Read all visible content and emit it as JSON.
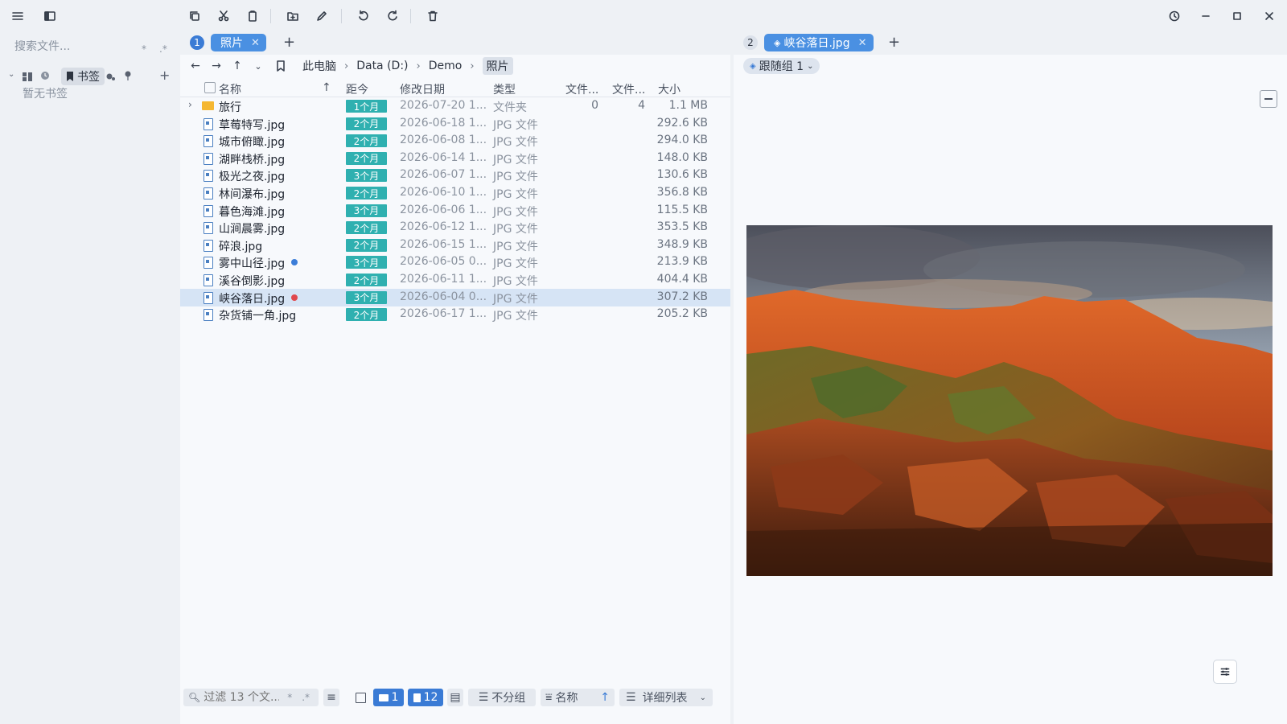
{
  "toolbar": {
    "icons": [
      "menu-icon",
      "sidebar-toggle-icon",
      "copy-icon",
      "cut-icon",
      "paste-icon",
      "new-folder-icon",
      "rename-icon",
      "undo-icon",
      "redo-icon",
      "delete-icon",
      "history-icon",
      "minimize-icon",
      "maximize-icon",
      "close-icon"
    ]
  },
  "sidebar": {
    "search_placeholder": "搜索文件...",
    "search_opt1": "*",
    "search_opt2": ".*",
    "bookmark_label": "书签",
    "empty_text": "暂无书签"
  },
  "left_pane": {
    "tab_number": "1",
    "tab_label": "照片",
    "add_tab": "+",
    "breadcrumb": [
      "此电脑",
      "Data (D:)",
      "Demo",
      "照片"
    ],
    "columns": {
      "name": "名称",
      "age": "距今",
      "modified": "修改日期",
      "type": "类型",
      "files": "文件...",
      "folders": "文件...",
      "size": "大小"
    },
    "rows": [
      {
        "name": "旅行",
        "age": "1个月",
        "modified": "2026-07-20 1...",
        "type": "文件夹",
        "files": "0",
        "folders": "4",
        "size": "1.1 MB",
        "kind": "folder"
      },
      {
        "name": "草莓特写.jpg",
        "age": "2个月",
        "modified": "2026-06-18 1...",
        "type": "JPG 文件",
        "size": "292.6 KB"
      },
      {
        "name": "城市俯瞰.jpg",
        "age": "2个月",
        "modified": "2026-06-08 1...",
        "type": "JPG 文件",
        "size": "294.0 KB"
      },
      {
        "name": "湖畔栈桥.jpg",
        "age": "2个月",
        "modified": "2026-06-14 1...",
        "type": "JPG 文件",
        "size": "148.0 KB"
      },
      {
        "name": "极光之夜.jpg",
        "age": "3个月",
        "modified": "2026-06-07 1...",
        "type": "JPG 文件",
        "size": "130.6 KB"
      },
      {
        "name": "林间瀑布.jpg",
        "age": "2个月",
        "modified": "2026-06-10 1...",
        "type": "JPG 文件",
        "size": "356.8 KB"
      },
      {
        "name": "暮色海滩.jpg",
        "age": "3个月",
        "modified": "2026-06-06 1...",
        "type": "JPG 文件",
        "size": "115.5 KB"
      },
      {
        "name": "山涧晨雾.jpg",
        "age": "2个月",
        "modified": "2026-06-12 1...",
        "type": "JPG 文件",
        "size": "353.5 KB"
      },
      {
        "name": "碎浪.jpg",
        "age": "2个月",
        "modified": "2026-06-15 1...",
        "type": "JPG 文件",
        "size": "348.9 KB"
      },
      {
        "name": "雾中山径.jpg",
        "age": "3个月",
        "modified": "2026-06-05 0...",
        "type": "JPG 文件",
        "size": "213.9 KB",
        "tag": "#3b7dd8"
      },
      {
        "name": "溪谷倒影.jpg",
        "age": "2个月",
        "modified": "2026-06-11 1...",
        "type": "JPG 文件",
        "size": "404.4 KB"
      },
      {
        "name": "峡谷落日.jpg",
        "age": "3个月",
        "modified": "2026-06-04 0...",
        "type": "JPG 文件",
        "size": "307.2 KB",
        "tag": "#e0474c",
        "selected": true
      },
      {
        "name": "杂货铺一角.jpg",
        "age": "2个月",
        "modified": "2026-06-17 1...",
        "type": "JPG 文件",
        "size": "205.2 KB"
      }
    ],
    "status": {
      "filter_placeholder": "过滤 13 个文...",
      "filter_opt1": "*",
      "filter_opt2": ".*",
      "folder_count": "1",
      "file_count": "12",
      "group_label": "不分组",
      "sort_label": "名称",
      "view_label": "详细列表"
    }
  },
  "right_pane": {
    "tab_number": "2",
    "tab_label": "峡谷落日.jpg",
    "add_tab": "+",
    "follow_group": "跟随组 1"
  },
  "colors": {
    "accent": "#4a90e2",
    "age_badge": "#2fb0b0",
    "folder": "#f5b731",
    "selection": "#d6e4f5"
  }
}
